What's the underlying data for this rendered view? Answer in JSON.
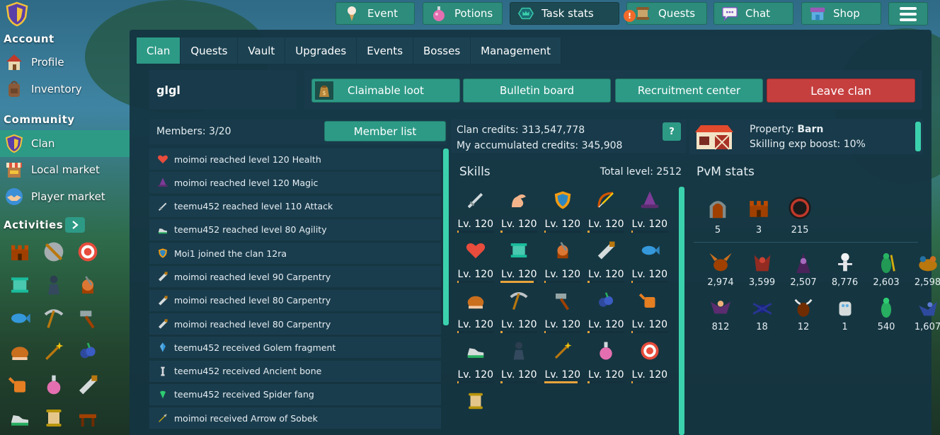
{
  "sidebar": {
    "account_title": "Account",
    "profile_label": "Profile",
    "inventory_label": "Inventory",
    "community_title": "Community",
    "clan_label": "Clan",
    "local_market_label": "Local market",
    "player_market_label": "Player market",
    "activities_title": "Activities",
    "activities": [
      "castle",
      "shield-target",
      "target",
      "sewing",
      "thief",
      "woodcutting",
      "fish",
      "pickaxe",
      "hammer",
      "turkey",
      "wand",
      "berries",
      "watering-can",
      "potion",
      "saw",
      "shoe",
      "scroll",
      "table"
    ]
  },
  "topbar": {
    "event_label": "Event",
    "potions_label": "Potions",
    "task_stats_label": "Task stats",
    "quests_label": "Quests",
    "quests_badge": "!",
    "chat_label": "Chat",
    "shop_label": "Shop"
  },
  "tabs": [
    "Clan",
    "Quests",
    "Vault",
    "Upgrades",
    "Events",
    "Bosses",
    "Management"
  ],
  "clan": {
    "name": "glgl",
    "claimable_loot": "Claimable loot",
    "bulletin_board": "Bulletin board",
    "recruitment_center": "Recruitment center",
    "leave_clan": "Leave clan",
    "members_count": "Members: 3/20",
    "member_list_btn": "Member list",
    "credits_line": "Clan credits: 313,547,778",
    "accumulated_line": "My accumulated credits: 345,908",
    "help_label": "?",
    "property_prefix": "Property: ",
    "property_value": "Barn",
    "skilling_boost": "Skilling exp boost: 10%"
  },
  "feed": [
    {
      "icon": "heart",
      "text": "moimoi reached level 120 Health"
    },
    {
      "icon": "wizard-hat",
      "text": "moimoi reached level 120 Magic"
    },
    {
      "icon": "sword",
      "text": "teemu452 reached level 110 Attack"
    },
    {
      "icon": "shoe",
      "text": "teemu452 reached level 80 Agility"
    },
    {
      "icon": "shield",
      "text": "Moi1 joined the clan 12ra"
    },
    {
      "icon": "saw",
      "text": "moimoi reached level 90 Carpentry"
    },
    {
      "icon": "saw",
      "text": "moimoi reached level 80 Carpentry"
    },
    {
      "icon": "saw",
      "text": "moimoi reached level 80 Carpentry"
    },
    {
      "icon": "crystal",
      "text": "teemu452 received Golem fragment"
    },
    {
      "icon": "bone",
      "text": "teemu452 received Ancient bone"
    },
    {
      "icon": "fang",
      "text": "teemu452 received Spider fang"
    },
    {
      "icon": "arrow",
      "text": "moimoi received Arrow of Sobek"
    }
  ],
  "skills_panel": {
    "title": "Skills",
    "total_level": "Total level: 2512",
    "skills": [
      {
        "icon": "sword",
        "level": "Lv. 120",
        "progress": 0.05
      },
      {
        "icon": "arm",
        "level": "Lv. 120",
        "progress": 0.05
      },
      {
        "icon": "shield",
        "level": "Lv. 120",
        "progress": 0.05
      },
      {
        "icon": "bow",
        "level": "Lv. 120",
        "progress": 0.05
      },
      {
        "icon": "wizard-hat",
        "level": "Lv. 120",
        "progress": 0.05
      },
      {
        "icon": "heart",
        "level": "Lv. 120",
        "progress": 0.05
      },
      {
        "icon": "sewing",
        "level": "Lv. 120",
        "progress": 0.9
      },
      {
        "icon": "woodcutting",
        "level": "Lv. 120",
        "progress": 0.05
      },
      {
        "icon": "saw",
        "level": "Lv. 120",
        "progress": 0.05
      },
      {
        "icon": "fish",
        "level": "Lv. 120",
        "progress": 0.05
      },
      {
        "icon": "turkey",
        "level": "Lv. 120",
        "progress": 0.05
      },
      {
        "icon": "pickaxe",
        "level": "Lv. 120",
        "progress": 0.05
      },
      {
        "icon": "hammer",
        "level": "Lv. 120",
        "progress": 0.05
      },
      {
        "icon": "berries",
        "level": "Lv. 120",
        "progress": 0.05
      },
      {
        "icon": "watering-can",
        "level": "Lv. 120",
        "progress": 0.05
      },
      {
        "icon": "shoe",
        "level": "Lv. 120",
        "progress": 0.05
      },
      {
        "icon": "thief",
        "level": "Lv. 120",
        "progress": 0.05
      },
      {
        "icon": "wand",
        "level": "Lv. 120",
        "progress": 0.9
      },
      {
        "icon": "potion",
        "level": "Lv. 120",
        "progress": 0.05
      },
      {
        "icon": "target",
        "level": "Lv. 120",
        "progress": 0.05
      },
      {
        "icon": "scroll",
        "level": "",
        "progress": 0
      }
    ]
  },
  "pvm": {
    "title": "PvM stats",
    "top": [
      {
        "icon": "dungeon-door",
        "value": "5"
      },
      {
        "icon": "castle",
        "value": "3"
      },
      {
        "icon": "portal",
        "value": "215"
      }
    ],
    "bosses": [
      {
        "icon": "griffin",
        "value": "2,974"
      },
      {
        "icon": "demon",
        "value": "3,599"
      },
      {
        "icon": "dark-mage",
        "value": "2,507"
      },
      {
        "icon": "skeleton",
        "value": "8,776"
      },
      {
        "icon": "sobek",
        "value": "2,603"
      },
      {
        "icon": "chimera",
        "value": "2,598"
      },
      {
        "icon": "harpy",
        "value": "812"
      },
      {
        "icon": "spider",
        "value": "18"
      },
      {
        "icon": "minotaur",
        "value": "12"
      },
      {
        "icon": "golem",
        "value": "1"
      },
      {
        "icon": "lizard",
        "value": "540"
      },
      {
        "icon": "dragon",
        "value": "1,607"
      }
    ]
  },
  "colors": {
    "accent": "#2d9a86",
    "danger": "#c63f3f",
    "panel": "#183a4a",
    "bar": "#e8a33a"
  }
}
